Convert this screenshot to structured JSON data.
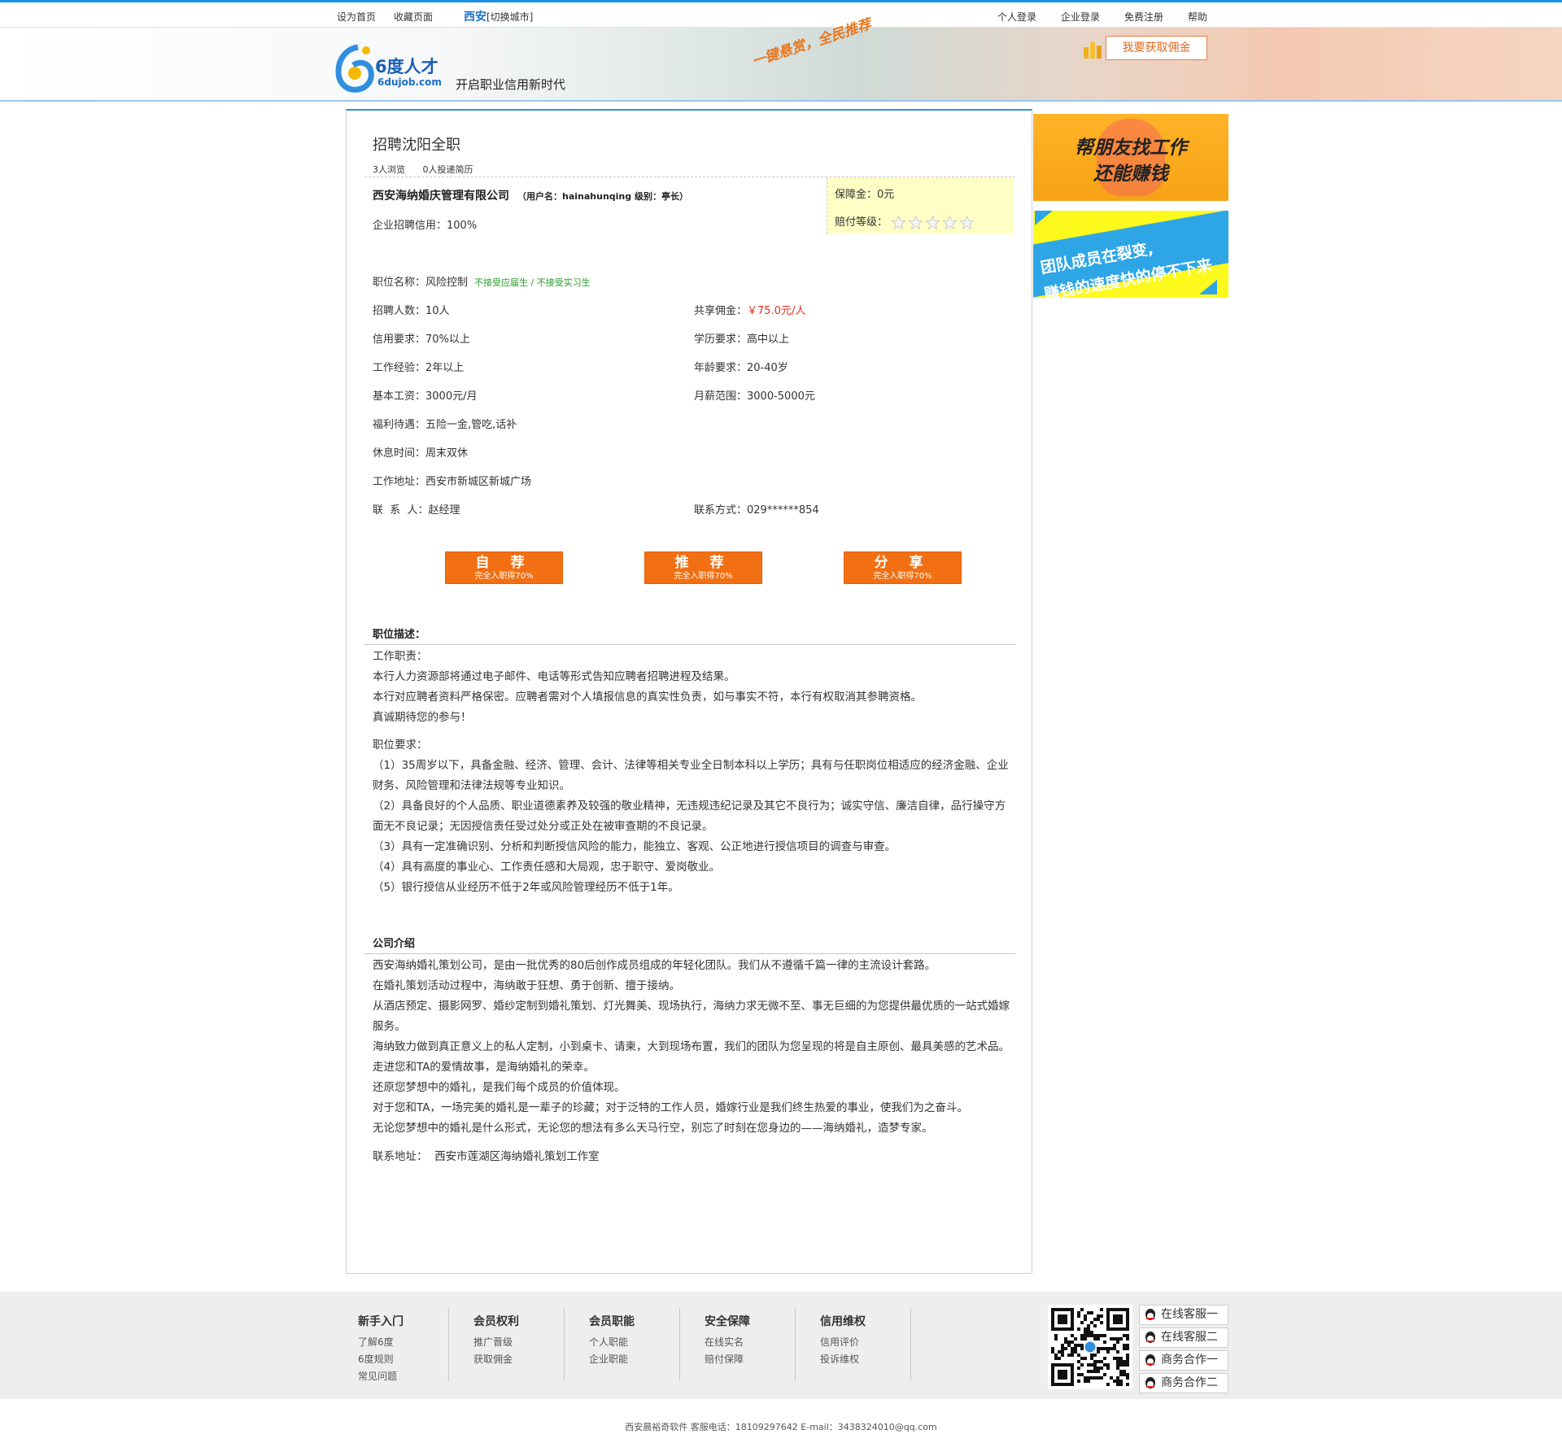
{
  "topbar": {
    "set_home": "设为首页",
    "favorite": "收藏页面",
    "city": "西安",
    "switch_city": "[切换城市]",
    "personal_login": "个人登录",
    "company_login": "企业登录",
    "register": "免费注册",
    "help": "帮助"
  },
  "header": {
    "logo_name": "6度人才",
    "logo_url": "6dujob.com",
    "slogan": "开启职业信用新时代",
    "hand_slogan": "一键悬赏，全民推荐",
    "commission_button": "我要获取佣金"
  },
  "job": {
    "title": "招聘沈阳全职",
    "views": "3人浏览",
    "resumes": "0人投递简历",
    "company": "西安海纳婚庆管理有限公司",
    "company_meta": "（用户名：hainahunqing 级别：亭长）",
    "credit": "企业招聘信用：100%",
    "guarantee": "保障金：0元",
    "payout_level_label": "赔付等级：",
    "payout_stars": 0,
    "position_label": "职位名称：",
    "position_value": "风险控制",
    "position_tags": "不接受应届生 / 不接受实习生",
    "fields": {
      "headcount": "招聘人数：10人",
      "commission_label": "共享佣金：",
      "commission_value": "￥75.0元/人",
      "credit_req": "信用要求：70%以上",
      "education": "学历要求：高中以上",
      "experience": "工作经验：2年以上",
      "age": "年龄要求：20-40岁",
      "base_salary": "基本工资：3000元/月",
      "salary_range": "月薪范围：3000-5000元",
      "benefits": "福利待遇：五险一金,管吃,话补",
      "rest": "休息时间：周末双休",
      "address": "工作地址：西安市新城区新城广场",
      "contact": "联  系  人：赵经理",
      "contact_method": "联系方式：029******854"
    },
    "buttons": [
      {
        "label": "自  荐",
        "sub": "完全入职得70%"
      },
      {
        "label": "推  荐",
        "sub": "完全入职得70%"
      },
      {
        "label": "分  享",
        "sub": "完全入职得70%"
      }
    ]
  },
  "description": {
    "title": "职位描述：",
    "duty_title": "工作职责：",
    "duties": [
      "本行人力资源部将通过电子邮件、电话等形式告知应聘者招聘进程及结果。",
      "本行对应聘者资料严格保密。应聘者需对个人填报信息的真实性负责，如与事实不符，本行有权取消其参聘资格。",
      "真诚期待您的参与！"
    ],
    "req_title": "职位要求：",
    "requirements": [
      "（1）35周岁以下，具备金融、经济、管理、会计、法律等相关专业全日制本科以上学历；具有与任职岗位相适应的经济金融、企业财务、风险管理和法律法规等专业知识。",
      "（2）具备良好的个人品质、职业道德素养及较强的敬业精神，无违规违纪记录及其它不良行为；诚实守信、廉洁自律，品行操守方面无不良记录；无因授信责任受过处分或正处在被审查期的不良记录。",
      "（3）具有一定准确识别、分析和判断授信风险的能力，能独立、客观、公正地进行授信项目的调查与审查。",
      "（4）具有高度的事业心、工作责任感和大局观，忠于职守、爱岗敬业。",
      "（5）银行授信从业经历不低于2年或风险管理经历不低于1年。"
    ]
  },
  "company_intro": {
    "title": "公司介绍",
    "paragraphs": [
      "西安海纳婚礼策划公司，是由一批优秀的80后创作成员组成的年轻化团队。我们从不遵循千篇一律的主流设计套路。",
      "在婚礼策划活动过程中，海纳敢于狂想、勇于创新、擅于接纳。",
      "从酒店预定、摄影网罗、婚纱定制到婚礼策划、灯光舞美、现场执行，海纳力求无微不至、事无巨细的为您提供最优质的一站式婚嫁服务。",
      "海纳致力做到真正意义上的私人定制，小到桌卡、请柬，大到现场布置，我们的团队为您呈现的将是自主原创、最具美感的艺术品。",
      "走进您和TA的爱情故事，是海纳婚礼的荣幸。",
      "还原您梦想中的婚礼，是我们每个成员的价值体现。",
      "对于您和TA，一场完美的婚礼是一辈子的珍藏；对于泛特的工作人员，婚嫁行业是我们终生热爱的事业，使我们为之奋斗。",
      "无论您梦想中的婚礼是什么形式，无论您的想法有多么天马行空，别忘了时刻在您身边的——海纳婚礼，造梦专家。"
    ],
    "address": "联系地址：  西安市莲湖区海纳婚礼策划工作室"
  },
  "sidebar": {
    "ad1_line1": "帮朋友找工作",
    "ad1_line2": "还能赚钱",
    "ad2_line1": "团队成员在裂变,",
    "ad2_line2": "赚钱的速度快的停不下来"
  },
  "footer": {
    "columns": [
      {
        "title": "新手入门",
        "links": [
          "了解6度",
          "6度规则",
          "常见问题"
        ]
      },
      {
        "title": "会员权利",
        "links": [
          "推广晋级",
          "获取佣金"
        ]
      },
      {
        "title": "会员职能",
        "links": [
          "个人职能",
          "企业职能"
        ]
      },
      {
        "title": "安全保障",
        "links": [
          "在线实名",
          "赔付保障"
        ]
      },
      {
        "title": "信用维权",
        "links": [
          "信用评价",
          "投诉维权"
        ]
      }
    ],
    "service": [
      "在线客服一",
      "在线客服二",
      "商务合作一",
      "商务合作二"
    ],
    "copyright": "西安晨裕奇软件  客服电话：18109297642 E-mail：3438324010@qq.com"
  },
  "colors": {
    "accent_blue": "#2b93e0",
    "orange_button": "#f26f13",
    "commission_red": "#e0301e",
    "tag_green": "#2a9c2a"
  }
}
